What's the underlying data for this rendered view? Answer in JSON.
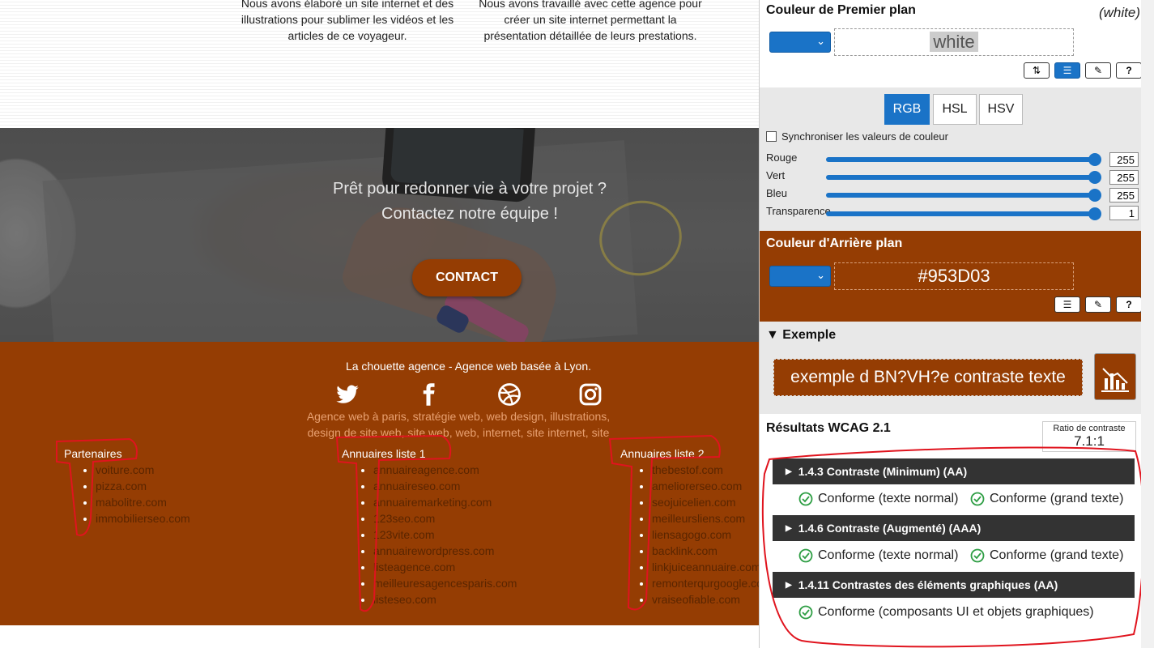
{
  "site": {
    "service_1": "Nous avons élaboré un site internet et des illustrations pour sublimer les vidéos et les articles de ce voyageur.",
    "service_2": "Nous avons travaillé avec cette agence pour créer un site internet permettant la présentation détaillée de leurs prestations.",
    "hero_line1": "Prêt pour redonner vie à votre projet ?",
    "hero_line2": "Contactez notre équipe !",
    "contact_label": "CONTACT",
    "footer_title": "La chouette agence - Agence web basée à Lyon.",
    "seo_text": "Agence web à paris, stratégie web, web design, illustrations, design de site web, site web, web, internet, site internet, site",
    "columns": [
      {
        "title": "Partenaires",
        "items": [
          "voiture.com",
          "pizza.com",
          "mabolitre.com",
          "immobilierseo.com"
        ]
      },
      {
        "title": "Annuaires liste 1",
        "items": [
          "annuaireagence.com",
          "annuaireseo.com",
          "annuairemarketing.com",
          "123seo.com",
          "123vite.com",
          "annuairewordpress.com",
          "listeagence.com",
          "meilleuresagencesparis.com",
          "listeseo.com"
        ]
      },
      {
        "title": "Annuaires liste 2",
        "items": [
          "thebestof.com",
          "ameliorerseo.com",
          "seojuicelien.com",
          "meilleursliens.com",
          "liensagogo.com",
          "backlink.com",
          "linkjuiceannuaire.com",
          "remonterqurgoogle.com",
          "vraiseofiable.com"
        ]
      }
    ]
  },
  "panel": {
    "foreground": {
      "title": "Couleur de Premier plan",
      "note": "(white)",
      "value": "white"
    },
    "tabs": [
      "RGB",
      "HSL",
      "HSV"
    ],
    "sync_label": "Synchroniser les valeurs de couleur",
    "sliders": [
      {
        "label": "Rouge",
        "value": "255"
      },
      {
        "label": "Vert",
        "value": "255"
      },
      {
        "label": "Bleu",
        "value": "255"
      },
      {
        "label": "Transparence",
        "value": "1"
      }
    ],
    "background": {
      "title": "Couleur d'Arrière plan",
      "value": "#953D03"
    },
    "example": {
      "title": "Exemple",
      "text": "exemple d BN?VH?e contraste texte"
    },
    "wcag": {
      "title": "Résultats WCAG 2.1",
      "ratio_label": "Ratio de contraste",
      "ratio_value": "7.1:1",
      "criteria": [
        {
          "name": "1.4.3 Contraste (Minimum) (AA)",
          "results": [
            "Conforme (texte normal)",
            "Conforme (grand texte)"
          ]
        },
        {
          "name": "1.4.6 Contraste (Augmenté) (AAA)",
          "results": [
            "Conforme (texte normal)",
            "Conforme (grand texte)"
          ]
        },
        {
          "name": "1.4.11 Contrastes des éléments graphiques (AA)",
          "results": [
            "Conforme (composants UI et objets graphiques)"
          ]
        }
      ]
    }
  },
  "colors": {
    "brand": "#953D03",
    "accent": "#1a73c7",
    "pass": "#2e9e44",
    "annotation": "#e0141e"
  }
}
